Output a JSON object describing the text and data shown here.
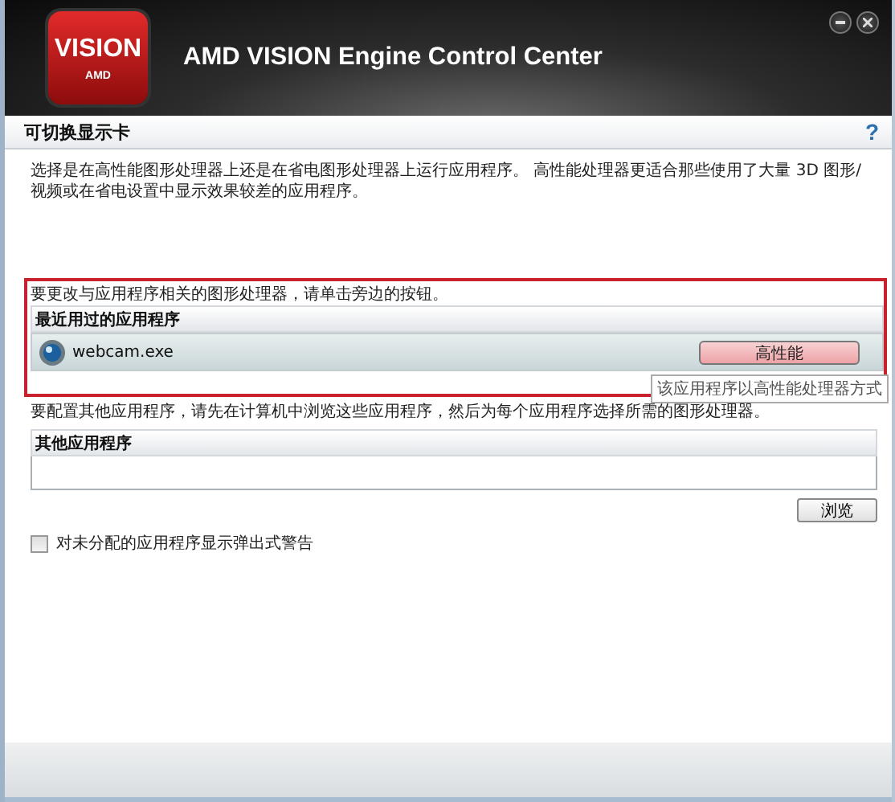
{
  "window": {
    "logo": {
      "wordmark": "VISION",
      "brand": "AMD"
    },
    "title": "AMD VISION Engine Control Center",
    "controls": [
      {
        "kind": "minimize"
      },
      {
        "kind": "close"
      }
    ]
  },
  "page": {
    "title": "可切换显示卡",
    "help": "?",
    "description": "选择是在高性能图形处理器上还是在省电图形处理器上运行应用程序。 高性能处理器更适合那些使用了大量 3D 图形/视频或在省电设置中显示效果较差的应用程序。"
  },
  "recent": {
    "highlighted": true,
    "instruction": "要更改与应用程序相关的图形处理器，请单击旁边的按钮。",
    "header": "最近用过的应用程序",
    "apps": [
      {
        "name": "webcam.exe",
        "mode": "高性能",
        "tooltip": "该应用程序以高性能处理器方式"
      }
    ]
  },
  "other": {
    "instruction": "要配置其他应用程序，请先在计算机中浏览这些应用程序，然后为每个应用程序选择所需的图形处理器。",
    "header": "其他应用程序",
    "browse": "浏览"
  },
  "warning": {
    "label": "对未分配的应用程序显示弹出式警告",
    "checked": false
  }
}
